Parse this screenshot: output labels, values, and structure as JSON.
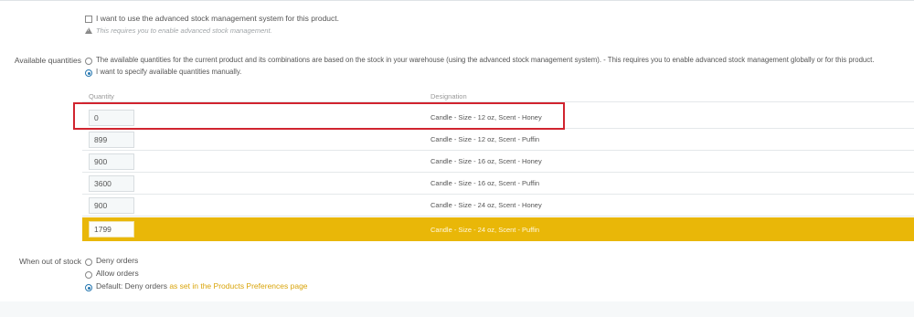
{
  "advanced_stock": {
    "checkbox_label": "I want to use the advanced stock management system for this product.",
    "warning": "This requires you to enable advanced stock management."
  },
  "available_quantities": {
    "label": "Available quantities",
    "option_auto": "The available quantities for the current product and its combinations are based on the stock in your warehouse (using the advanced stock management system).  - This requires you to enable advanced stock management globally or for this product.",
    "option_manual": "I want to specify available quantities manually."
  },
  "table": {
    "header_quantity": "Quantity",
    "header_designation": "Designation",
    "rows": [
      {
        "quantity": "0",
        "designation": "Candle - Size - 12 oz, Scent - Honey"
      },
      {
        "quantity": "899",
        "designation": "Candle - Size - 12 oz, Scent - Puffin"
      },
      {
        "quantity": "900",
        "designation": "Candle - Size - 16 oz, Scent - Honey"
      },
      {
        "quantity": "3600",
        "designation": "Candle - Size - 16 oz, Scent - Puffin"
      },
      {
        "quantity": "900",
        "designation": "Candle - Size - 24 oz, Scent - Honey"
      },
      {
        "quantity": "1799",
        "designation": "Candle - Size - 24 oz, Scent - Puffin"
      }
    ]
  },
  "out_of_stock": {
    "label": "When out of stock",
    "deny": "Deny orders",
    "allow": "Allow orders",
    "default_prefix": "Default: Deny orders",
    "default_link": "as set in the Products Preferences page"
  },
  "colors": {
    "highlight_row": "#e9b708",
    "annotation_box": "#d1242f",
    "radio_checked": "#2677b0",
    "link": "#d9a40a"
  },
  "icons": [
    "checkbox-icon",
    "warning-icon",
    "radio-icon"
  ]
}
